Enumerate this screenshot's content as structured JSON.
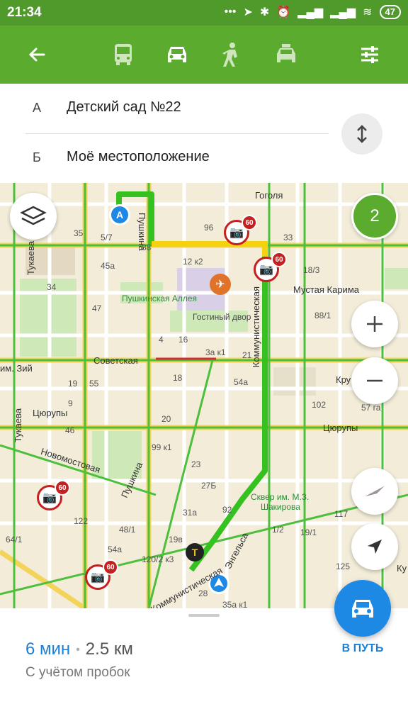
{
  "status": {
    "time": "21:34",
    "battery": "47"
  },
  "toolbar": {
    "back_icon": "arrow-left-icon",
    "modes": [
      "bus-icon",
      "car-icon",
      "pedestrian-icon",
      "taxi-icon"
    ],
    "settings_icon": "sliders-icon"
  },
  "route": {
    "from_letter": "А",
    "from_name": "Детский сад №22",
    "to_letter": "Б",
    "to_name": "Моё местоположение"
  },
  "map": {
    "alternatives_count": "2",
    "marker_a": "A",
    "streets": {
      "pushkina": "Пушкина",
      "pushkina2": "Пушкина",
      "gogolya": "Гоголя",
      "karima": "Мустая Карима",
      "sovetskaya": "Советская",
      "tsyurupy": "Цюрупы",
      "tsyurupy2": "Цюрупы",
      "novomostovaya": "Новомостовая",
      "tukaeva": "Тукаева",
      "tukaeva2": "Тукаева",
      "kommunisticheskaya": "Коммунистическая",
      "kommunisticheskaya2": "Коммунистическая",
      "engelsa": "Энгельса",
      "kru": "Кру",
      "ku": "Ку",
      "im_zii": "им. Зий"
    },
    "places": {
      "alleya": "Пушкинская Аллея",
      "gostiny": "Гостиный двор",
      "skver": "Сквер им. М.З.",
      "skver2": "Шакирова"
    },
    "house_numbers": [
      "5/7",
      "88",
      "96",
      "33",
      "45а",
      "12 к2",
      "18/3",
      "34",
      "47",
      "88/1",
      "4",
      "16",
      "3а к1",
      "21",
      "55",
      "18",
      "54а",
      "102",
      "20",
      "46",
      "99 к1",
      "23",
      "27Б",
      "122",
      "31а",
      "92",
      "1/2",
      "19/1",
      "48/1",
      "19в",
      "54а",
      "120/2 к3",
      "125",
      "117",
      "28",
      "35а к1",
      "64/1",
      "57 га",
      "35",
      "9",
      "19"
    ],
    "speed_limit": "60"
  },
  "sheet": {
    "eta_time": "6 мин",
    "eta_distance": "2.5 км",
    "traffic_note": "С учётом пробок",
    "go_label": "В ПУТЬ"
  },
  "colors": {
    "brand_green": "#5aab2e",
    "route_green": "#35c11f",
    "route_yellow": "#f4d20e",
    "accent_blue": "#1e88e5"
  }
}
